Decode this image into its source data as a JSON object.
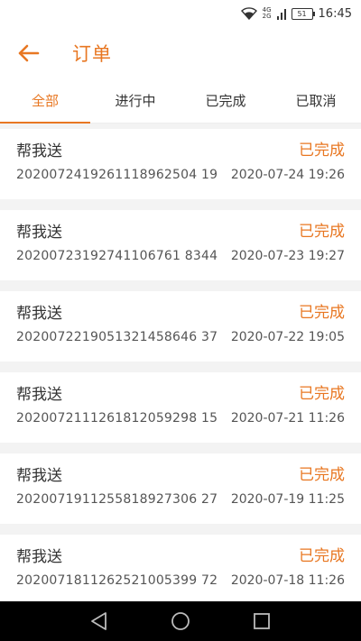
{
  "status_bar": {
    "time": "16:45",
    "battery": "51",
    "network_top": "4G",
    "network_bottom": "2G"
  },
  "header": {
    "title": "订单",
    "accent": "#e87722"
  },
  "tabs": [
    {
      "label": "全部",
      "active": true
    },
    {
      "label": "进行中",
      "active": false
    },
    {
      "label": "已完成",
      "active": false
    },
    {
      "label": "已取消",
      "active": false
    }
  ],
  "orders": [
    {
      "type": "帮我送",
      "status": "已完成",
      "order_no": "2020072419261118962504 19",
      "time": "2020-07-24 19:26"
    },
    {
      "type": "帮我送",
      "status": "已完成",
      "order_no": "20200723192741106761 8344",
      "time": "2020-07-23 19:27"
    },
    {
      "type": "帮我送",
      "status": "已完成",
      "order_no": "2020072219051321458646 37",
      "time": "2020-07-22 19:05"
    },
    {
      "type": "帮我送",
      "status": "已完成",
      "order_no": "2020072111261812059298 15",
      "time": "2020-07-21 11:26"
    },
    {
      "type": "帮我送",
      "status": "已完成",
      "order_no": "2020071911255818927306 27",
      "time": "2020-07-19 11:25"
    },
    {
      "type": "帮我送",
      "status": "已完成",
      "order_no": "2020071811262521005399 72",
      "time": "2020-07-18 11:26"
    }
  ]
}
